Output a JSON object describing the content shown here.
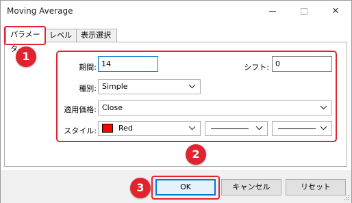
{
  "window": {
    "title": "Moving Average"
  },
  "titlebar": {
    "close_glyph": "✕"
  },
  "tabs": [
    {
      "label": "パラメータ",
      "active": true
    },
    {
      "label": "レベル",
      "active": false
    },
    {
      "label": "表示選択",
      "active": false
    }
  ],
  "params": {
    "period_label": "期間:",
    "period_value": "14",
    "shift_label": "シフト:",
    "shift_value": "0",
    "method_label": "種別:",
    "method_value": "Simple",
    "price_label": "適用価格:",
    "price_value": "Close",
    "style_label": "スタイル:",
    "color_name": "Red",
    "color_hex": "#ff0000"
  },
  "callouts": [
    "1",
    "2",
    "3"
  ],
  "buttons": {
    "ok": "OK",
    "cancel": "キャンセル",
    "reset": "リセット"
  },
  "accent_colors": {
    "highlight": "#e0232f",
    "focus": "#0078d7"
  }
}
